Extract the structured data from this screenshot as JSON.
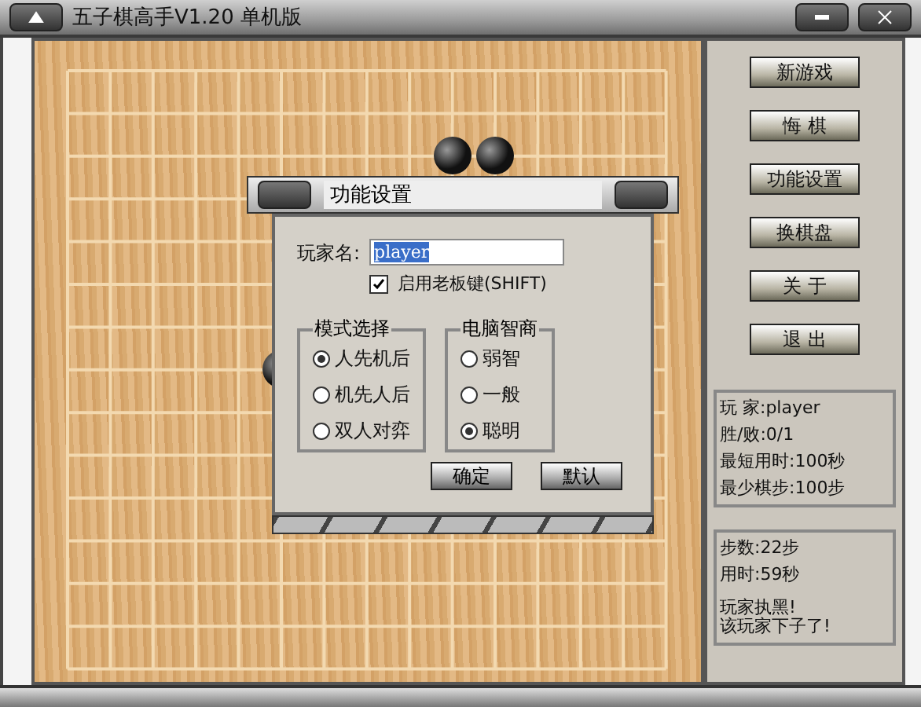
{
  "window": {
    "title": "五子棋高手V1.20 单机版"
  },
  "side_buttons": [
    "新游戏",
    "悔 棋",
    "功能设置",
    "换棋盘",
    "关 于",
    "退 出"
  ],
  "stats": [
    "玩 家:player",
    "胜/败:0/1",
    "最短用时:100秒",
    "最少棋步:100步"
  ],
  "status": [
    "步数:22步",
    "用时:59秒",
    "玩家执黑!",
    "该玩家下子了!"
  ],
  "dialog": {
    "title": "功能设置",
    "name_label": "玩家名:",
    "name_value": "player",
    "boss_key": {
      "label": "启用老板键(SHIFT)",
      "checked": true
    },
    "groups": [
      {
        "title": "模式选择",
        "options": [
          {
            "label": "人先机后",
            "selected": true
          },
          {
            "label": "机先人后",
            "selected": false
          },
          {
            "label": "双人对弈",
            "selected": false
          }
        ]
      },
      {
        "title": "电脑智商",
        "options": [
          {
            "label": "弱智",
            "selected": false
          },
          {
            "label": "一般",
            "selected": false
          },
          {
            "label": "聪明",
            "selected": true
          }
        ]
      }
    ],
    "buttons": [
      "确定",
      "默认"
    ]
  }
}
